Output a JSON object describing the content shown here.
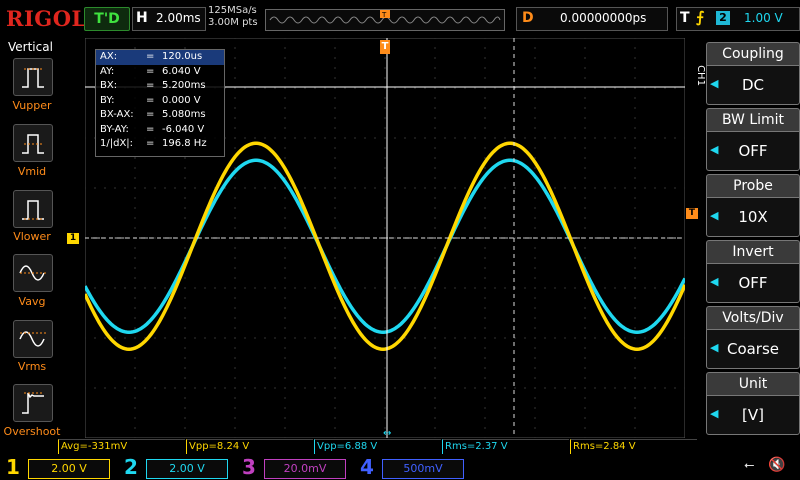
{
  "topbar": {
    "logo": "RIGOL",
    "trigger_status": "T'D",
    "horizontal_label": "H",
    "timebase": "2.00ms",
    "sample_rate": "125MSa/s",
    "memory_depth": "3.00M pts",
    "delay_label": "D",
    "delay_value": "0.00000000ps",
    "trigger_label": "T",
    "trigger_edge_icon": "rising-edge-icon",
    "trigger_source": "2",
    "trigger_level": "1.00 V"
  },
  "left_menu": {
    "title": "Vertical",
    "items": [
      {
        "label": "Vupper",
        "icon": "vupper-icon"
      },
      {
        "label": "Vmid",
        "icon": "vmid-icon"
      },
      {
        "label": "Vlower",
        "icon": "vlower-icon"
      },
      {
        "label": "Vavg",
        "icon": "vavg-icon"
      },
      {
        "label": "Vrms",
        "icon": "vrms-icon"
      },
      {
        "label": "Overshoot",
        "icon": "overshoot-icon"
      }
    ]
  },
  "cursor_readout": {
    "rows": [
      {
        "label": "AX:",
        "value": "120.0us"
      },
      {
        "label": "AY:",
        "value": "6.040 V"
      },
      {
        "label": "BX:",
        "value": "5.200ms"
      },
      {
        "label": "BY:",
        "value": "0.000 V"
      },
      {
        "label": "BX-AX:",
        "value": "5.080ms"
      },
      {
        "label": "BY-AY:",
        "value": "-6.040 V"
      },
      {
        "label": "1/|dX|:",
        "value": "196.8 Hz"
      }
    ]
  },
  "markers": {
    "ch1_marker": "1",
    "trigger_pos_marker": "T",
    "trigger_level_marker": "T"
  },
  "right_menu": {
    "channel_tag": "CH1",
    "items": [
      {
        "title": "Coupling",
        "value": "DC"
      },
      {
        "title": "BW Limit",
        "value": "OFF"
      },
      {
        "title": "Probe",
        "value": "10X"
      },
      {
        "title": "Invert",
        "value": "OFF"
      },
      {
        "title": "Volts/Div",
        "value": "Coarse"
      },
      {
        "title": "Unit",
        "value": "[V]"
      }
    ]
  },
  "measurements": [
    {
      "text": "Avg=-331mV",
      "color": "#ffd700"
    },
    {
      "text": "Vpp=8.24 V",
      "color": "#ffd700"
    },
    {
      "text": "Vpp=6.88 V",
      "color": "#1fd8f0"
    },
    {
      "text": "Rms=2.37 V",
      "color": "#1fd8f0"
    },
    {
      "text": "Rms=2.84 V",
      "color": "#ffd700"
    }
  ],
  "channels": [
    {
      "num": "1",
      "scale": "2.00 V",
      "color": "#ffd700"
    },
    {
      "num": "2",
      "scale": "2.00 V",
      "color": "#1fd8f0"
    },
    {
      "num": "3",
      "scale": "20.0mV",
      "color": "#c040c0"
    },
    {
      "num": "4",
      "scale": "500mV",
      "color": "#4060ff"
    }
  ],
  "status_icons": [
    "usb-icon",
    "speaker-muted-icon"
  ],
  "colors": {
    "ch1": "#ffd700",
    "ch2": "#1fd8f0",
    "cursor": "#ffffff",
    "trigger": "#ff8c1a",
    "grid": "#3c3c3c"
  },
  "waveforms": {
    "time_per_div_ms": 2,
    "volts_per_div": 2,
    "ch1": {
      "amplitude_v": 4.12,
      "offset_v": -0.33,
      "period_ms": 10.16,
      "phase_note": "zero crossing rising at 5.2ms"
    },
    "ch2": {
      "amplitude_v": 3.44,
      "offset_v": -0.33,
      "period_ms": 10.16
    }
  }
}
